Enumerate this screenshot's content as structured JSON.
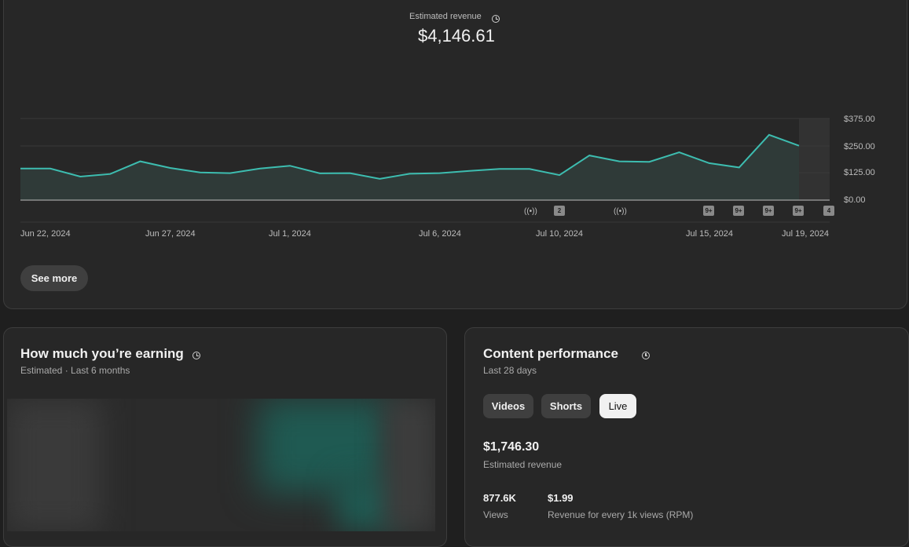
{
  "revenue": {
    "label": "Estimated revenue",
    "total": "$4,146.61",
    "see_more": "See more"
  },
  "chart_data": {
    "type": "area",
    "x": [
      "Jun 22, 2024",
      "Jun 23, 2024",
      "Jun 24, 2024",
      "Jun 25, 2024",
      "Jun 26, 2024",
      "Jun 27, 2024",
      "Jun 28, 2024",
      "Jun 29, 2024",
      "Jun 30, 2024",
      "Jul 1, 2024",
      "Jul 2, 2024",
      "Jul 3, 2024",
      "Jul 4, 2024",
      "Jul 5, 2024",
      "Jul 6, 2024",
      "Jul 7, 2024",
      "Jul 8, 2024",
      "Jul 9, 2024",
      "Jul 10, 2024",
      "Jul 11, 2024",
      "Jul 12, 2024",
      "Jul 13, 2024",
      "Jul 14, 2024",
      "Jul 15, 2024",
      "Jul 16, 2024",
      "Jul 17, 2024",
      "Jul 18, 2024",
      "Jul 19, 2024"
    ],
    "values": [
      145,
      145,
      108,
      120,
      178,
      148,
      127,
      124,
      145,
      158,
      123,
      124,
      98,
      121,
      124,
      134,
      143,
      143,
      115,
      205,
      178,
      176,
      220,
      170,
      150,
      300,
      250
    ],
    "xticks": [
      "Jun 22, 2024",
      "Jun 27, 2024",
      "Jul 1, 2024",
      "Jul 6, 2024",
      "Jul 10, 2024",
      "Jul 15, 2024",
      "Jul 19, 2024"
    ],
    "yticks": [
      "$375.00",
      "$250.00",
      "$125.00",
      "$0.00"
    ],
    "ylim": [
      0,
      375
    ],
    "line_color": "#3dbdb0",
    "grid": true,
    "markers": [
      {
        "type": "live",
        "date": "Jul 8, 2024"
      },
      {
        "type": "count",
        "label": "2",
        "date": "Jul 10, 2024"
      },
      {
        "type": "live",
        "date": "Jul 11, 2024"
      },
      {
        "type": "count",
        "label": "9+",
        "date": "Jul 15, 2024"
      },
      {
        "type": "count",
        "label": "9+",
        "date": "Jul 16, 2024"
      },
      {
        "type": "count",
        "label": "9+",
        "date": "Jul 17, 2024"
      },
      {
        "type": "count",
        "label": "9+",
        "date": "Jul 18, 2024"
      },
      {
        "type": "count",
        "label": "4",
        "date": "Jul 19, 2024"
      }
    ]
  },
  "earning": {
    "title": "How much you’re earning",
    "subtitle": "Estimated · Last 6 months"
  },
  "performance": {
    "title": "Content performance",
    "subtitle": "Last 28 days",
    "tabs": [
      "Videos",
      "Shorts",
      "Live"
    ],
    "active_tab": "Live",
    "revenue_value": "$1,746.30",
    "revenue_label": "Estimated revenue",
    "views_value": "877.6K",
    "views_label": "Views",
    "rpm_value": "$1.99",
    "rpm_label": "Revenue for every 1k views (RPM)"
  }
}
